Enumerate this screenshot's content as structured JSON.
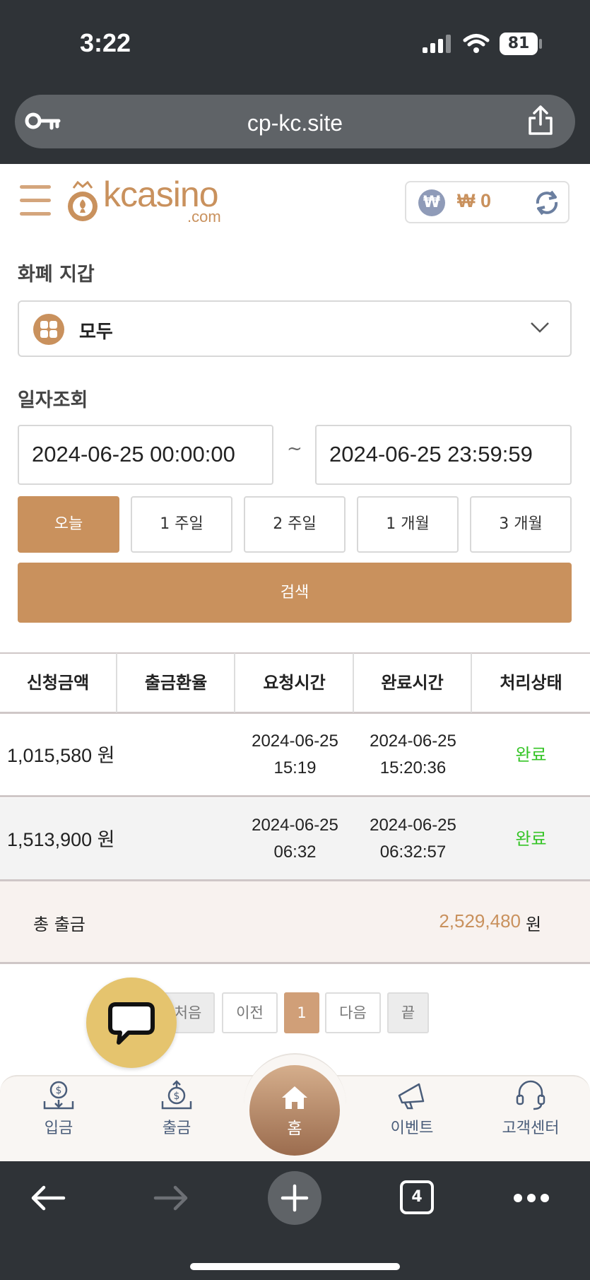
{
  "status_bar": {
    "time": "3:22",
    "battery": "81"
  },
  "browser": {
    "url": "cp-kc.site",
    "tabs_count": "4"
  },
  "header": {
    "logo_main": "kcasino",
    "logo_sub": ".com",
    "currency_symbol": "₩",
    "balance": "₩ 0"
  },
  "filters": {
    "wallet_label": "화폐 지갑",
    "wallet_value": "모두",
    "date_label": "일자조회",
    "date_from": "2024-06-25 00:00:00",
    "date_sep": "~",
    "date_to": "2024-06-25 23:59:59",
    "ranges": [
      "오늘",
      "1 주일",
      "2 주일",
      "1 개월",
      "3 개월"
    ],
    "active_range": "오늘",
    "search_label": "검색"
  },
  "table": {
    "headers": [
      "신청금액",
      "출금환율",
      "요청시간",
      "완료시간",
      "처리상태"
    ],
    "rows": [
      {
        "amount": "1,015,580 원",
        "rate": "",
        "req_date": "2024-06-25",
        "req_time": "15:19",
        "done_date": "2024-06-25",
        "done_time": "15:20:36",
        "status": "완료"
      },
      {
        "amount": "1,513,900 원",
        "rate": "",
        "req_date": "2024-06-25",
        "req_time": "06:32",
        "done_date": "2024-06-25",
        "done_time": "06:32:57",
        "status": "완료"
      }
    ],
    "total_label": "총 출금",
    "total_value": "2,529,480",
    "total_unit": "원"
  },
  "pagination": {
    "first": "처음",
    "prev": "이전",
    "current": "1",
    "next": "다음",
    "last": "끝"
  },
  "tabbar": {
    "deposit": "입금",
    "withdraw": "출금",
    "home": "홈",
    "event": "이벤트",
    "support": "고객센터"
  },
  "colors": {
    "accent": "#c9915d",
    "done": "#35c426",
    "dark": "#2f3337"
  }
}
